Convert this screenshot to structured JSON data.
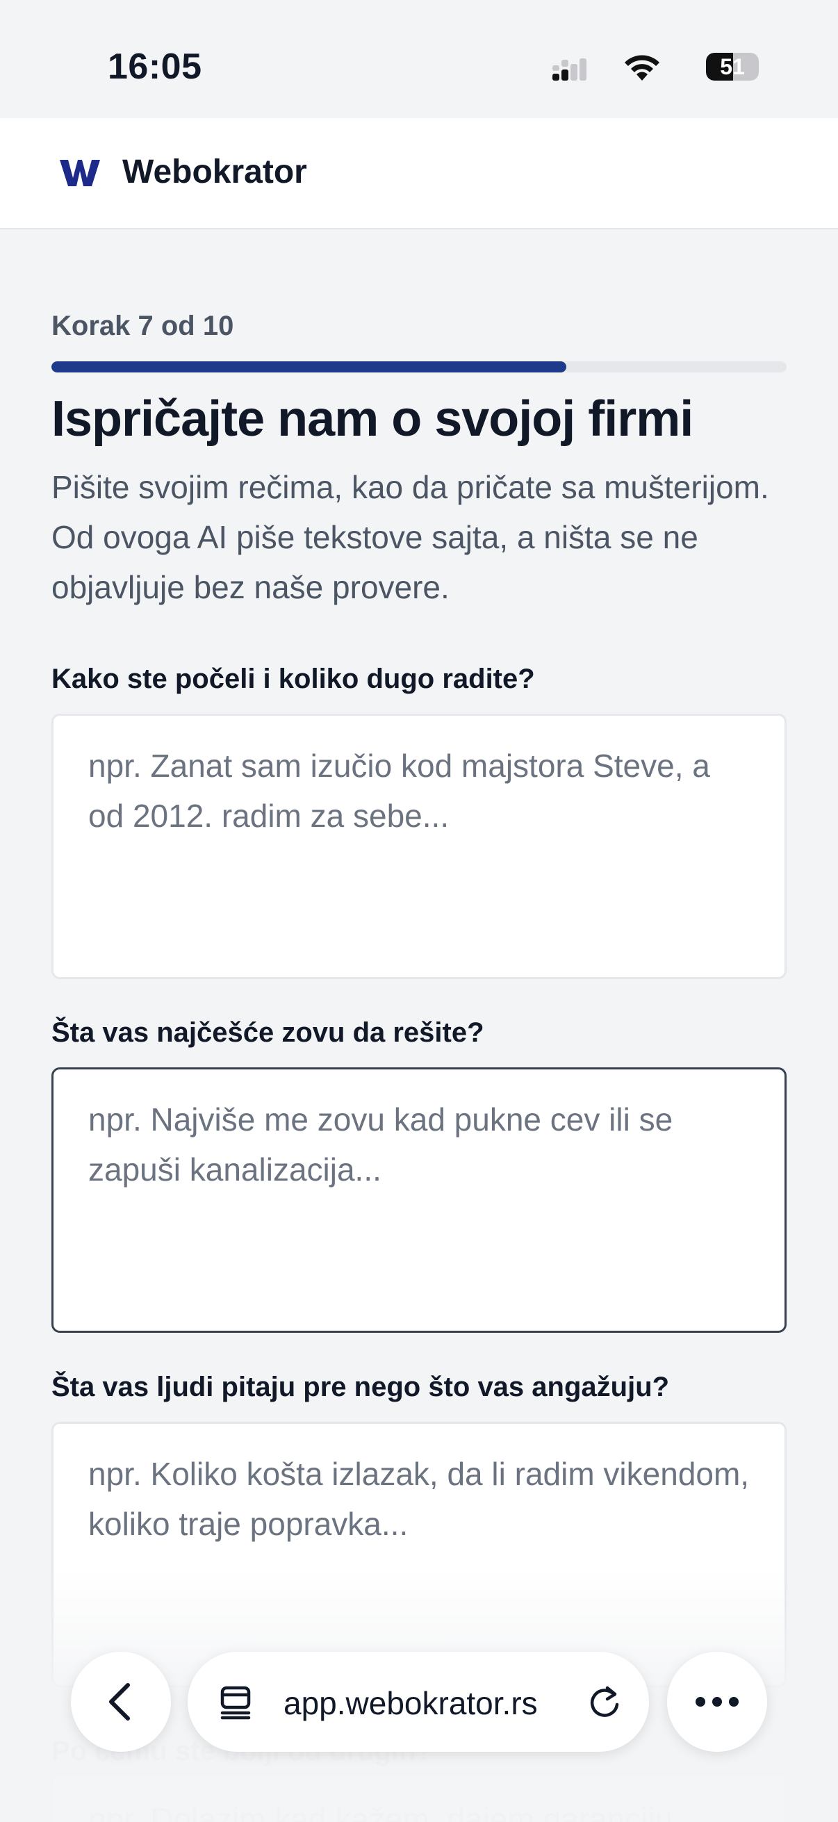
{
  "status_bar": {
    "time": "16:05",
    "battery": "51",
    "battery_level": 0.51,
    "icons": [
      "cellular-signal-icon",
      "wifi-icon",
      "battery-icon"
    ]
  },
  "header": {
    "logo_icon": "webokrator-logo-icon",
    "brand": "Webokrator"
  },
  "wizard": {
    "step_label": "Korak 7 od 10",
    "progress": 0.7,
    "title": "Ispričajte nam o svojoj firmi",
    "subtitle": "Pišite svojim rečima, kao da pričate sa mušterijom. Od ovoga AI piše tekstove sajta, a ništa se ne objavljuje bez naše provere."
  },
  "fields": [
    {
      "label": "Kako ste počeli i koliko dugo radite?",
      "placeholder": "npr. Zanat sam izučio kod majstora Steve, a od 2012. radim za sebe..."
    },
    {
      "label": "Šta vas najčešće zovu da rešite?",
      "placeholder": "npr. Najviše me zovu kad pukne cev ili se zapuši kanalizacija..."
    },
    {
      "label": "Šta vas ljudi pitaju pre nego što vas angažuju?",
      "placeholder": "npr. Koliko košta izlazak, da li radim vikendom, koliko traje popravka..."
    }
  ],
  "partial_field": {
    "label": "Po čemu ste bolji od drugih?",
    "placeholder": "npr. Dolazim kad kažem, dajem garanciju..."
  },
  "browser": {
    "url": "app.webokrator.rs",
    "icons": [
      "chevron-left-icon",
      "tabs-icon",
      "reload-icon",
      "ellipsis-icon"
    ]
  }
}
